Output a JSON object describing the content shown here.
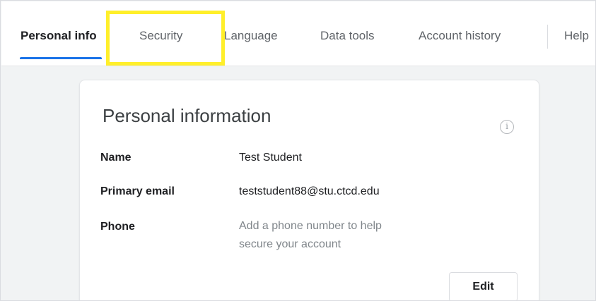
{
  "tabs": [
    {
      "label": "Personal info",
      "active": true
    },
    {
      "label": "Security",
      "active": false
    },
    {
      "label": "Language",
      "active": false
    },
    {
      "label": "Data tools",
      "active": false
    },
    {
      "label": "Account history",
      "active": false
    },
    {
      "label": "Help",
      "active": false
    }
  ],
  "highlighted_tab": "Security",
  "colors": {
    "accent": "#1a73e8",
    "highlight": "#ffef2a"
  },
  "card": {
    "title": "Personal information",
    "info_icon": "info-circle-icon",
    "rows": [
      {
        "label": "Name",
        "value": "Test Student"
      },
      {
        "label": "Primary email",
        "value": "teststudent88@stu.ctcd.edu"
      },
      {
        "label": "Phone",
        "value": "Add a phone number to help secure your account"
      }
    ],
    "edit_label": "Edit"
  }
}
